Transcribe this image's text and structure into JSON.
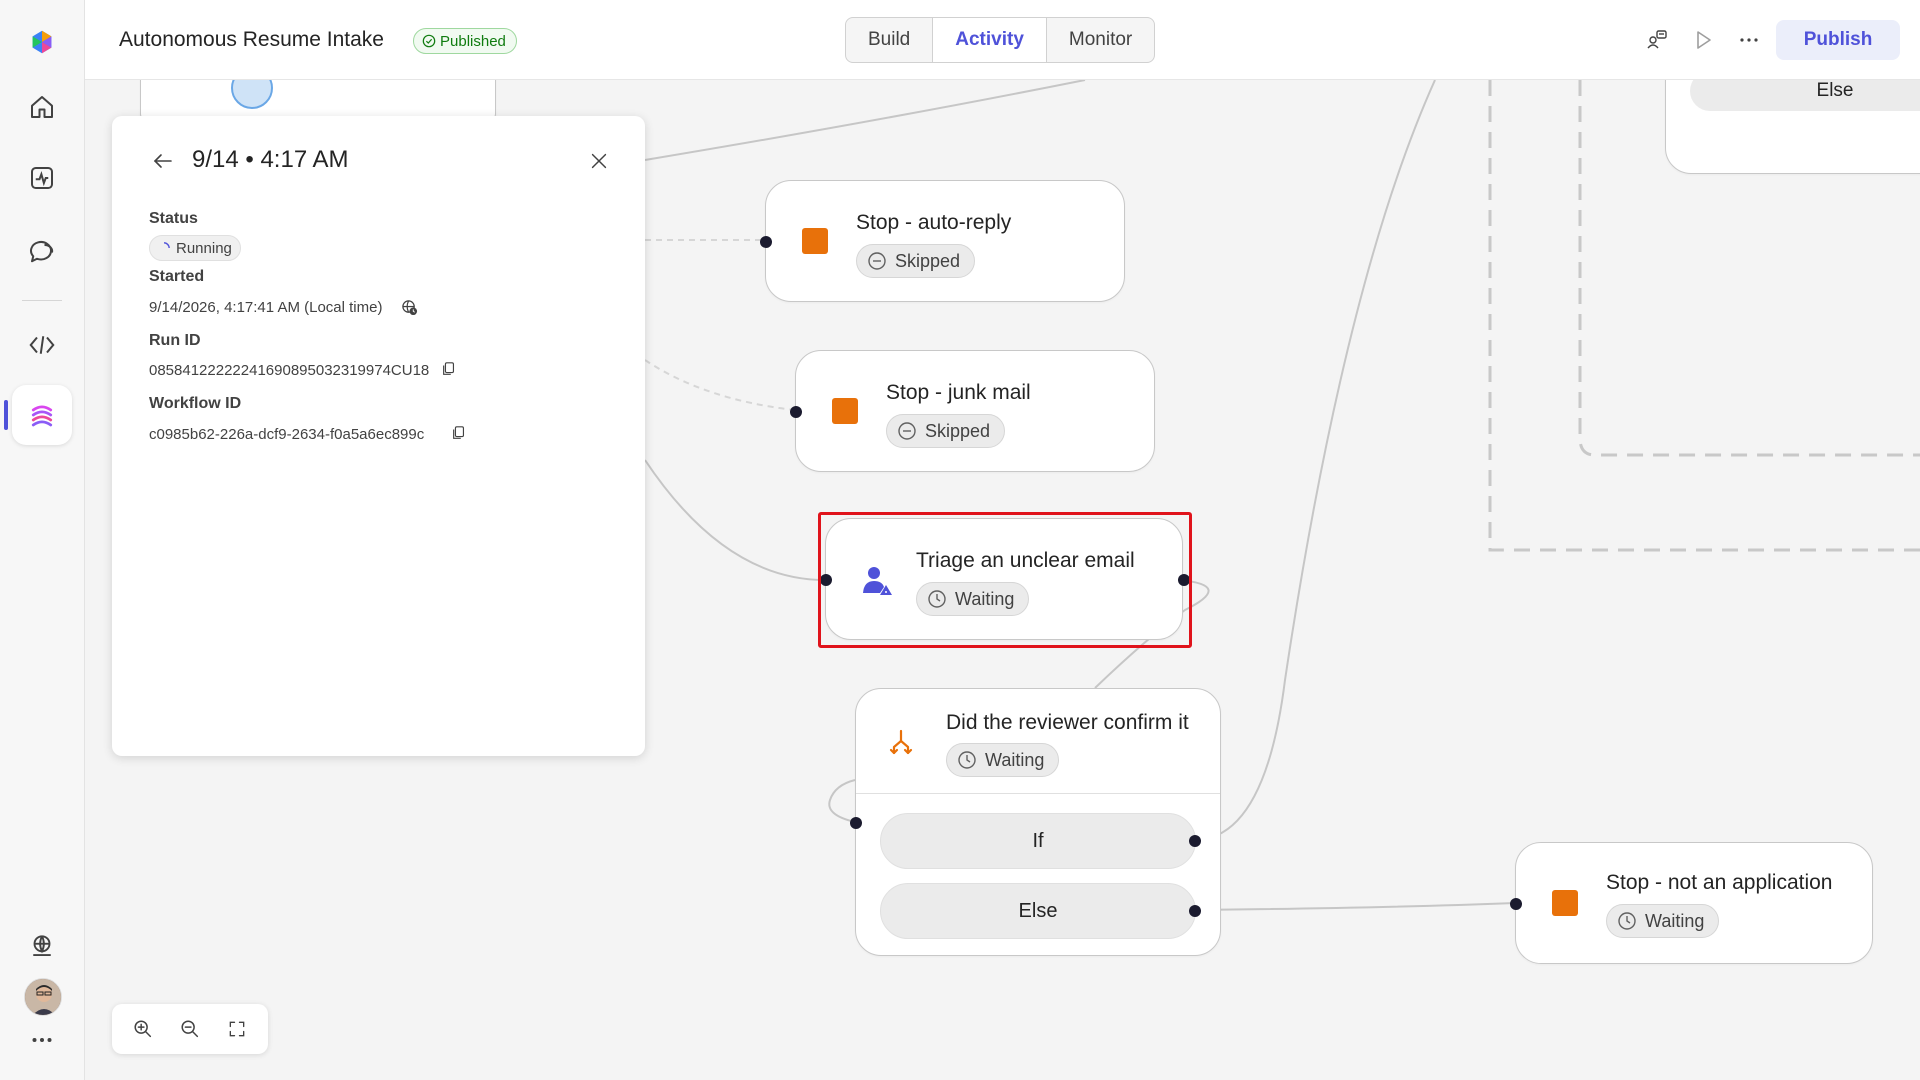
{
  "header": {
    "title": "Autonomous Resume Intake",
    "status_badge": "Published",
    "tabs": [
      {
        "label": "Build",
        "active": false
      },
      {
        "label": "Activity",
        "active": true
      },
      {
        "label": "Monitor",
        "active": false
      }
    ],
    "publish_label": "Publish"
  },
  "sidebar": {
    "items": [
      {
        "icon": "copilot-logo-icon"
      },
      {
        "icon": "home-icon"
      },
      {
        "icon": "activity-icon"
      },
      {
        "icon": "chat-icon"
      },
      {
        "icon": "code-icon"
      },
      {
        "icon": "workflow-icon",
        "active": true
      },
      {
        "icon": "globe-icon"
      },
      {
        "icon": "avatar"
      },
      {
        "icon": "more-icon"
      }
    ]
  },
  "details_panel": {
    "title": "9/14 • 4:17 AM",
    "status_label": "Status",
    "status_value": "Running",
    "started_label": "Started",
    "started_value": "9/14/2026, 4:17:41 AM (Local time)",
    "run_id_label": "Run ID",
    "run_id_value": "08584122222241690895032319974CU18",
    "workflow_id_label": "Workflow ID",
    "workflow_id_value": "c0985b62-226a-dcf9-2634-f0a5a6ec899c"
  },
  "nodes": {
    "stop_auto_reply": {
      "title": "Stop - auto-reply",
      "status": "Skipped"
    },
    "stop_junk_mail": {
      "title": "Stop - junk mail",
      "status": "Skipped"
    },
    "triage": {
      "title": "Triage an unclear email",
      "status": "Waiting"
    },
    "condition": {
      "title": "Did the reviewer confirm it",
      "status": "Waiting",
      "if_label": "If",
      "else_label": "Else"
    },
    "stop_not_app": {
      "title": "Stop - not an application",
      "status": "Waiting"
    },
    "partial_top_right": {
      "label": "Else"
    }
  },
  "colors": {
    "accent": "#4f52d9",
    "stop": "#e8710a",
    "highlight": "#e0131b",
    "published": "#107c10"
  }
}
